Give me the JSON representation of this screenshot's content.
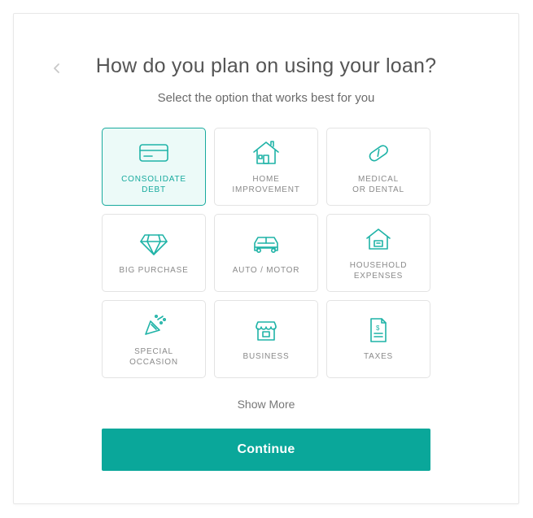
{
  "title": "How do you plan on using your loan?",
  "subtitle": "Select the option that works best for you",
  "options": [
    {
      "label": "CONSOLIDATE\nDEBT",
      "icon": "credit-card-icon",
      "selected": true
    },
    {
      "label": "HOME\nIMPROVEMENT",
      "icon": "house-icon",
      "selected": false
    },
    {
      "label": "MEDICAL\nOR DENTAL",
      "icon": "pill-icon",
      "selected": false
    },
    {
      "label": "BIG PURCHASE",
      "icon": "diamond-icon",
      "selected": false
    },
    {
      "label": "AUTO / MOTOR",
      "icon": "car-icon",
      "selected": false
    },
    {
      "label": "HOUSEHOLD\nEXPENSES",
      "icon": "home-expenses-icon",
      "selected": false
    },
    {
      "label": "SPECIAL\nOCCASION",
      "icon": "party-icon",
      "selected": false
    },
    {
      "label": "BUSINESS",
      "icon": "storefront-icon",
      "selected": false
    },
    {
      "label": "TAXES",
      "icon": "document-icon",
      "selected": false
    }
  ],
  "show_more_label": "Show More",
  "continue_label": "Continue",
  "colors": {
    "accent": "#0aa79a",
    "accent_light": "#ecfaf8",
    "border": "#e3e3e3"
  }
}
